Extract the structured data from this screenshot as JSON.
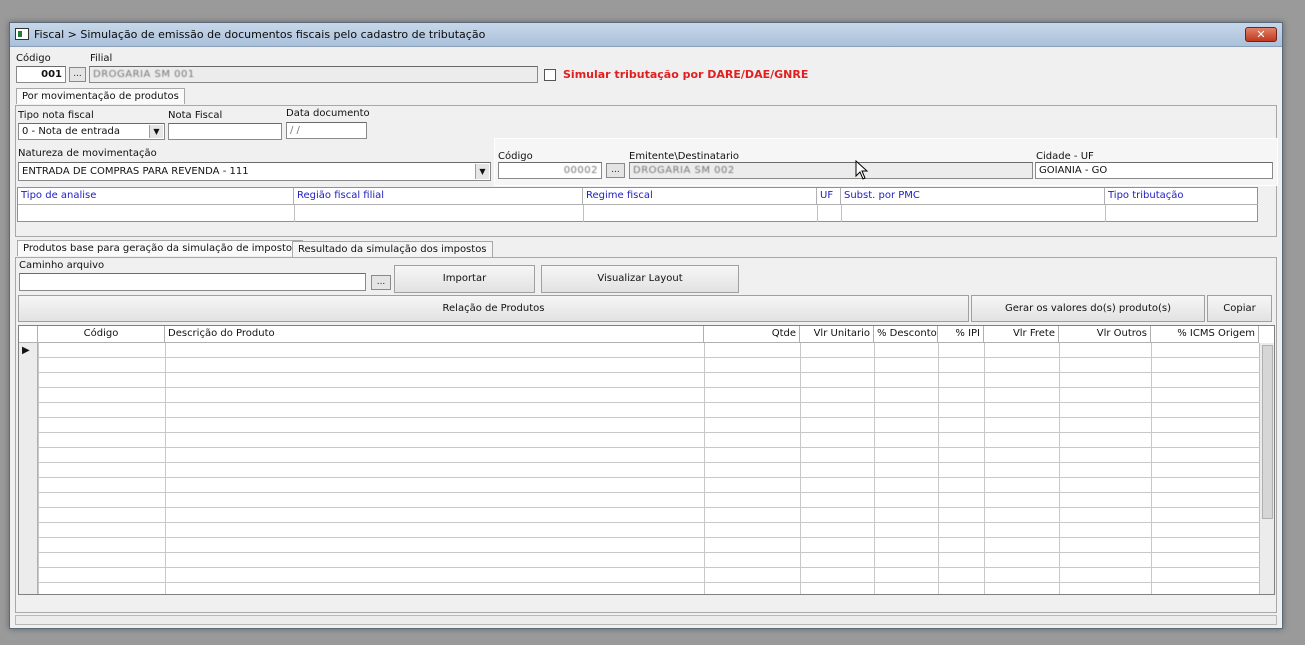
{
  "window": {
    "title": "Fiscal > Simulação de emissão de documentos fiscais pelo cadastro de tributação",
    "close_label": "✕"
  },
  "header": {
    "codigo_label": "Código",
    "codigo_value": "001",
    "filial_label": "Filial",
    "filial_value": "DROGARIA SM 001",
    "lookup_label": "...",
    "simular_label": "Simular tributação por DARE/DAE/GNRE"
  },
  "movement_tab": {
    "label": "Por movimentação de produtos"
  },
  "movement": {
    "tipo_nota_label": "Tipo nota fiscal",
    "tipo_nota_value": "0 - Nota de entrada",
    "nota_fiscal_label": "Nota Fiscal",
    "nota_fiscal_value": "",
    "data_documento_label": "Data documento",
    "data_documento_value": " /  /",
    "natureza_label": "Natureza de movimentação",
    "natureza_value": "ENTRADA DE COMPRAS PARA REVENDA - 111",
    "emit_codigo_label": "Código",
    "emit_codigo_value": "00002",
    "emit_lookup_label": "...",
    "emitente_label": "Emitente\\Destinatario",
    "emitente_value": "DROGARIA SM 002",
    "cidade_label": "Cidade - UF",
    "cidade_value": "GOIANIA - GO"
  },
  "analysis_grid": {
    "columns": [
      "Tipo de analise",
      "Região fiscal filial",
      "Regime fiscal",
      "UF",
      "Subst. por PMC",
      "Tipo tributação"
    ]
  },
  "tabs": [
    {
      "label": "Produtos base para geração da simulação de impostos"
    },
    {
      "label": "Resultado da simulação dos impostos"
    }
  ],
  "import": {
    "caminho_label": "Caminho arquivo",
    "caminho_value": "",
    "lookup_label": "...",
    "importar_label": "Importar",
    "visualizar_label": "Visualizar Layout"
  },
  "products": {
    "relacao_label": "Relação de Produtos",
    "gerar_label": "Gerar os valores do(s) produto(s)",
    "copiar_label": "Copiar",
    "columns": [
      "Código",
      "Descrição do Produto",
      "Qtde",
      "Vlr Unitario",
      "% Desconto",
      "% IPI",
      "Vlr Frete",
      "Vlr Outros",
      "% ICMS Origem"
    ],
    "row_indicator": "▶"
  },
  "colors": {
    "accent_red": "#e02020",
    "header_blue": "#2020c0"
  }
}
